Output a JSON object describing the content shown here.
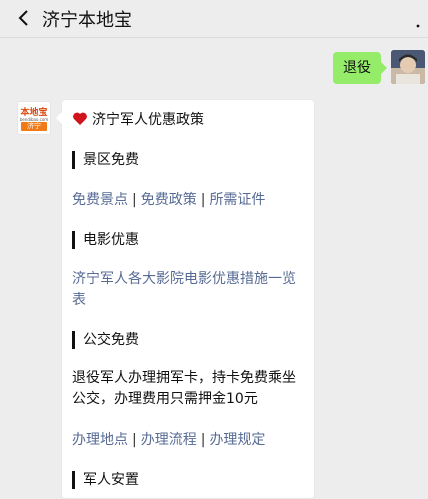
{
  "header": {
    "title": "济宁本地宝",
    "more_icon": "ellipsis-icon"
  },
  "messages": {
    "outgoing": {
      "text": "退役"
    },
    "bot_avatar": {
      "top_text": "本地宝",
      "small_text": "bendibao.com",
      "bottom_text": "济宁"
    },
    "card": {
      "title": "济宁军人优惠政策",
      "sections": {
        "scenic": {
          "heading": "景区免费",
          "links": [
            "免费景点",
            "免费政策",
            "所需证件"
          ]
        },
        "movie": {
          "heading": "电影优惠",
          "link_text": "济宁军人各大影院电影优惠措施一览表"
        },
        "bus": {
          "heading": "公交免费",
          "text": "退役军人办理拥军卡，持卡免费乘坐公交，办理费用只需押金10元",
          "links": [
            "办理地点",
            "办理流程",
            "办理规定"
          ]
        },
        "settle": {
          "heading": "军人安置"
        }
      }
    }
  },
  "colors": {
    "link": "#576b95",
    "bubble_out": "#95ec69",
    "bg": "#ededed"
  }
}
